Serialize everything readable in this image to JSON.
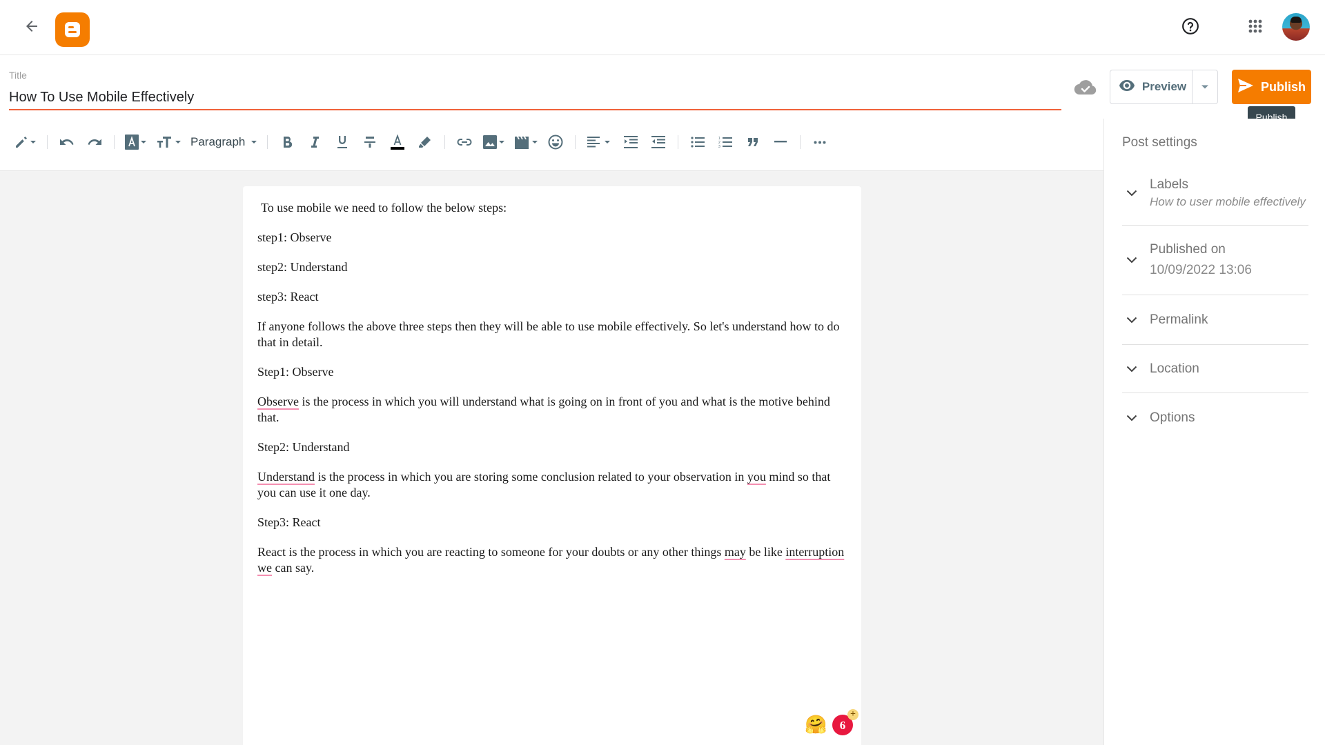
{
  "header": {
    "back_icon": "arrow-back-icon",
    "logo_icon": "blogger-logo-icon",
    "help_icon": "help-circle-icon",
    "apps_icon": "apps-grid-icon",
    "avatar_alt": "account-avatar"
  },
  "title": {
    "label": "Title",
    "value": "How To Use Mobile Effectively"
  },
  "actions": {
    "save_status_icon": "cloud-done-icon",
    "preview_label": "Preview",
    "preview_icon": "eye-icon",
    "preview_dropdown_icon": "caret-down-icon",
    "publish_label": "Publish",
    "publish_icon": "send-icon",
    "tooltip": "Publish"
  },
  "toolbar": {
    "items": [
      "pencil-mode",
      "undo",
      "redo",
      "text-background-color",
      "font-size",
      "paragraph-style",
      "bold",
      "italic",
      "underline",
      "strikethrough",
      "text-color",
      "highlight",
      "link",
      "insert-image",
      "insert-video",
      "insert-emoji",
      "align",
      "indent",
      "outdent",
      "bulleted-list",
      "numbered-list",
      "quote",
      "horizontal-rule",
      "more"
    ],
    "paragraph_label": "Paragraph",
    "text_color": "#000000"
  },
  "editor": {
    "paragraphs": [
      "To use mobile we need to follow the below steps:",
      "step1: Observe",
      "step2: Understand",
      "step3: React",
      "If anyone follows the above three steps then they will be able to use mobile effectively. So let's understand how to do that in detail.",
      "Step1: Observe",
      "Observe is the process in which you will understand what is going on in front of you and what is the motive behind that.",
      "Step2: Understand",
      "Understand is the process in which you are storing some conclusion related to your observation in you mind so that you can use it one day.",
      "Step3: React",
      "React is the process in which you are reacting to someone for your doubts or any other things may be like interruption we can say."
    ],
    "misspelled_words": [
      "Observe",
      "Understand",
      "you",
      "may",
      "interruption",
      "we"
    ],
    "floating": {
      "emoji": "🤗",
      "badge_count": "6",
      "badge_plus": "+"
    }
  },
  "sidebar": {
    "title": "Post settings",
    "items": [
      {
        "label": "Labels",
        "value": "How to user mobile effectively"
      },
      {
        "label": "Published on",
        "value": "10/09/2022 13:06"
      },
      {
        "label": "Permalink"
      },
      {
        "label": "Location"
      },
      {
        "label": "Options"
      }
    ]
  },
  "colors": {
    "brand": "#f57c00",
    "title_underline": "#f0613a",
    "icon": "#546e7a",
    "tooltip_bg": "#37474f",
    "spellcheck": "#f48fb1",
    "badge": "#e8183f"
  }
}
